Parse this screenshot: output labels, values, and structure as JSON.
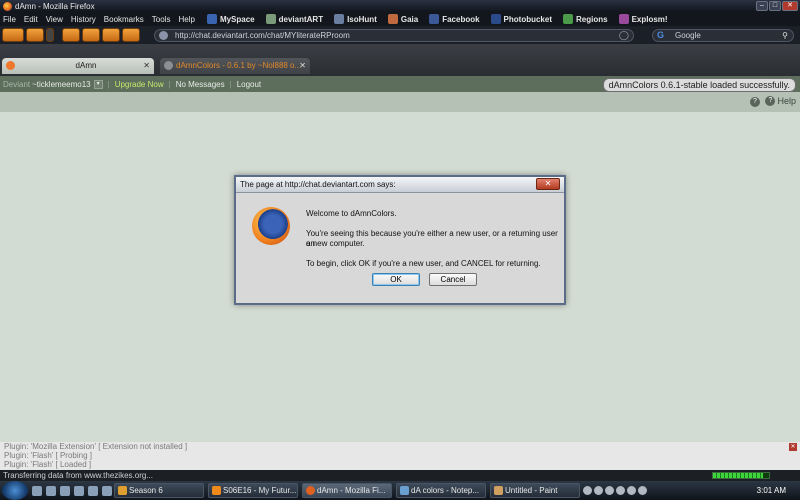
{
  "window": {
    "title": "dAmn - Mozilla Firefox"
  },
  "menu": [
    "File",
    "Edit",
    "View",
    "History",
    "Bookmarks",
    "Tools",
    "Help"
  ],
  "bookmarks": [
    "MySpace",
    "deviantART",
    "IsoHunt",
    "Gaia",
    "Facebook",
    "Photobucket",
    "Regions",
    "Explosm!"
  ],
  "nav": {
    "url": "http://chat.deviantart.com/chat/MYliterateRProom",
    "search_placeholder": "Google"
  },
  "tabs": [
    {
      "label": "dAmn"
    },
    {
      "label": "dAmnColors - 0.6.1 by ~Nol888 o..."
    }
  ],
  "dabar": {
    "deviant_label": "Deviant",
    "username": "~ticklemeemo13",
    "upgrade": "Upgrade Now",
    "messages": "No Messages",
    "logout": "Logout"
  },
  "notice": "dAmnColors 0.6.1-stable loaded successfully.",
  "help": "Help",
  "dialog": {
    "title": "The page at http://chat.deviantart.com says:",
    "line1": "Welcome to dAmnColors.",
    "line2": "You're seeing this because you're either a new user, or a returning user on",
    "line3": "a new computer.",
    "line4": "To begin, click OK if you're a new user, and CANCEL for returning.",
    "ok": "OK",
    "cancel": "Cancel"
  },
  "plugins": [
    "Plugin: 'Mozilla Extension' [ Extension not installed ]",
    "Plugin: 'Flash' [ Probing ]",
    "Plugin: 'Flash' [ Loaded ]"
  ],
  "status": "Transferring data from www.thezikes.org...",
  "taskbar": {
    "tasks": [
      "Season 6",
      "S06E16 - My Futur...",
      "dAmn - Mozilla Fi...",
      "dA colors - Notep...",
      "Untitled - Paint"
    ],
    "clock": "3:01 AM"
  }
}
